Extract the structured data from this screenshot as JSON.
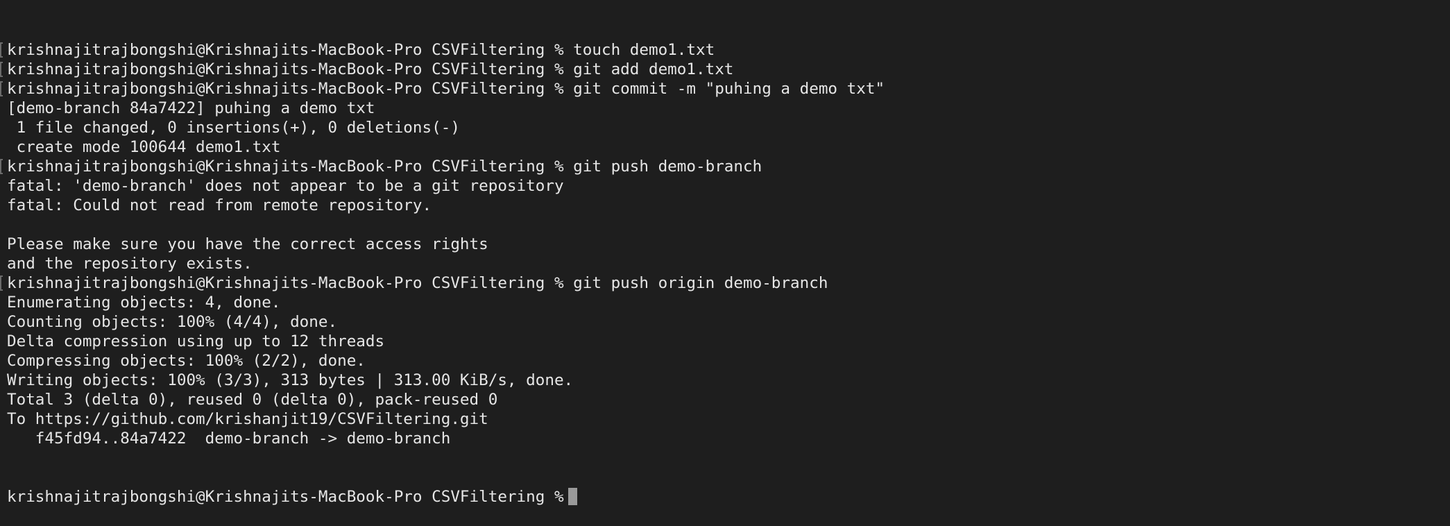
{
  "terminal": {
    "background": "#1e1e1e",
    "foreground": "#e6e6e6",
    "lines": [
      {
        "text": "krishnajitrajbongshi@Krishnajits-MacBook-Pro CSVFiltering % touch demo1.txt",
        "marked": true
      },
      {
        "text": "krishnajitrajbongshi@Krishnajits-MacBook-Pro CSVFiltering % git add demo1.txt",
        "marked": true
      },
      {
        "text": "krishnajitrajbongshi@Krishnajits-MacBook-Pro CSVFiltering % git commit -m \"puhing a demo txt\"",
        "marked": true
      },
      {
        "text": "[demo-branch 84a7422] puhing a demo txt",
        "marked": false
      },
      {
        "text": " 1 file changed, 0 insertions(+), 0 deletions(-)",
        "marked": false
      },
      {
        "text": " create mode 100644 demo1.txt",
        "marked": false
      },
      {
        "text": "krishnajitrajbongshi@Krishnajits-MacBook-Pro CSVFiltering % git push demo-branch",
        "marked": true
      },
      {
        "text": "fatal: 'demo-branch' does not appear to be a git repository",
        "marked": false
      },
      {
        "text": "fatal: Could not read from remote repository.",
        "marked": false
      },
      {
        "text": "",
        "marked": false
      },
      {
        "text": "Please make sure you have the correct access rights",
        "marked": false
      },
      {
        "text": "and the repository exists.",
        "marked": false
      },
      {
        "text": "krishnajitrajbongshi@Krishnajits-MacBook-Pro CSVFiltering % git push origin demo-branch",
        "marked": true
      },
      {
        "text": "Enumerating objects: 4, done.",
        "marked": false
      },
      {
        "text": "Counting objects: 100% (4/4), done.",
        "marked": false
      },
      {
        "text": "Delta compression using up to 12 threads",
        "marked": false
      },
      {
        "text": "Compressing objects: 100% (2/2), done.",
        "marked": false
      },
      {
        "text": "Writing objects: 100% (3/3), 313 bytes | 313.00 KiB/s, done.",
        "marked": false
      },
      {
        "text": "Total 3 (delta 0), reused 0 (delta 0), pack-reused 0",
        "marked": false
      },
      {
        "text": "To https://github.com/krishanjit19/CSVFiltering.git",
        "marked": false
      },
      {
        "text": "   f45fd94..84a7422  demo-branch -> demo-branch",
        "marked": false
      }
    ],
    "current_prompt": "krishnajitrajbongshi@Krishnajits-MacBook-Pro CSVFiltering %"
  }
}
